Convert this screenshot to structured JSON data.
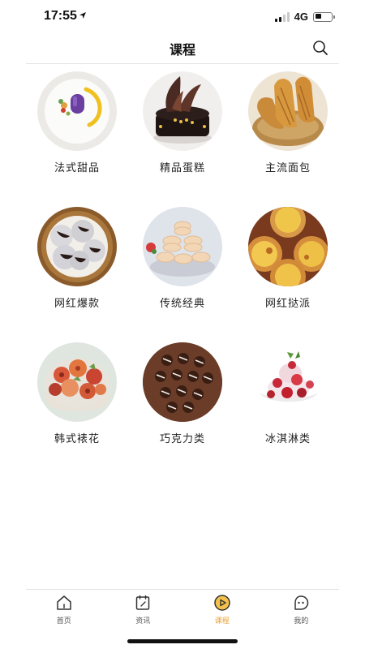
{
  "status_bar": {
    "time": "17:55",
    "network": "4G"
  },
  "header": {
    "title": "课程"
  },
  "courses": [
    {
      "label": "法式甜品"
    },
    {
      "label": "精品蛋糕"
    },
    {
      "label": "主流面包"
    },
    {
      "label": "网红爆款"
    },
    {
      "label": "传统经典"
    },
    {
      "label": "网红挞派"
    },
    {
      "label": "韩式裱花"
    },
    {
      "label": "巧克力类"
    },
    {
      "label": "冰淇淋类"
    }
  ],
  "tabs": [
    {
      "label": "首页",
      "icon": "home-icon"
    },
    {
      "label": "资讯",
      "icon": "news-icon"
    },
    {
      "label": "课程",
      "icon": "play-icon",
      "active": true
    },
    {
      "label": "我的",
      "icon": "profile-icon"
    }
  ],
  "colors": {
    "accent": "#e8a33a",
    "text": "#222222"
  }
}
